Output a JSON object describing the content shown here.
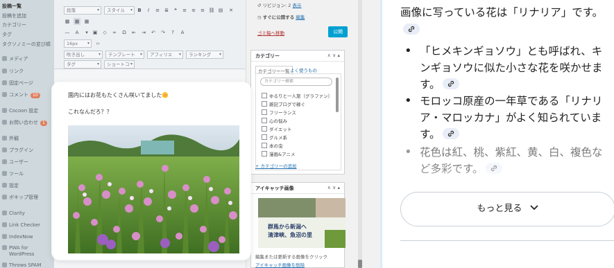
{
  "sidebar": {
    "items": [
      {
        "label": "投稿一覧"
      },
      {
        "label": "投稿を追加"
      },
      {
        "label": "カテゴリー"
      },
      {
        "label": "タグ"
      },
      {
        "label": "タクソノミーの並び順"
      },
      {
        "label": "メディア"
      },
      {
        "label": "リンク"
      },
      {
        "label": "固定ページ"
      },
      {
        "label": "コメント",
        "badge": "10"
      },
      {
        "label": "Cocoon 設定"
      },
      {
        "label": "お問い合わせ",
        "badge": "1"
      },
      {
        "label": "外観"
      },
      {
        "label": "プラグイン"
      },
      {
        "label": "ユーザー"
      },
      {
        "label": "ツール"
      },
      {
        "label": "設定"
      },
      {
        "label": "ボキップ管理"
      },
      {
        "label": "Clarity"
      },
      {
        "label": "Link Checker"
      },
      {
        "label": "IndexNow"
      },
      {
        "label": "PWA for"
      },
      {
        "label": "WordPress"
      },
      {
        "label": "Throws SPAM"
      }
    ]
  },
  "toolbar": {
    "format_select": "段落",
    "style_select": "スタイル",
    "size_select": "16px",
    "template_select": "吹き出し",
    "template2_select": "テンプレート",
    "affiliate_select": "アフィリエ",
    "ranking_select": "ランキング",
    "tag_select": "タグ",
    "shortcode_select": "ショートコ"
  },
  "editor": {
    "line1": "園内にはお花もたくさん咲いてました🌼",
    "line2": "これなんだろ？？"
  },
  "meta": {
    "revision_label": "リビジョン: 2",
    "revision_link": "表示",
    "publish_label": "すぐに公開する",
    "publish_link": "編集",
    "trash_link": "ゴミ箱へ移動",
    "publish_button": "公開",
    "category_title": "カテゴリー",
    "category_tab_all": "カテゴリー一覧",
    "category_tab_popular": "よく使うもの",
    "category_search": "カテゴリー検索",
    "categories": [
      "ゆるりと一人旅（グラファン）",
      "雑記ブログで稼ぐ",
      "フリーランス",
      "心の悩み",
      "ダイエット",
      "グルメ系",
      "本の虫",
      "漫画&アニメ"
    ],
    "add_category": "+ カテゴリーの追加",
    "eyecatch_title": "アイキャッチ画像",
    "eyecatch_caption1": "群馬から新潟へ",
    "eyecatch_caption2": "清津峡、魚沼の里",
    "eyecatch_note": "編集または更新する画像をクリック",
    "eyecatch_remove": "アイキャッチ画像を削除"
  },
  "answer": {
    "intro": "画像に写っている花は「リナリア」です。",
    "bullets": [
      "「ヒメキンギョソウ」とも呼ばれ、キンギョソウに似た小さな花を咲かせます。",
      "モロッコ原産の一年草である「リナリア・マロッカナ」がよく知られています。",
      "花色は紅、桃、紫紅、黄、白、複色など多彩です。"
    ],
    "more_button": "もっと見る"
  },
  "colors": {
    "accent": "#00a0d2",
    "link": "#2271b1",
    "chip": "#e8edf7"
  }
}
